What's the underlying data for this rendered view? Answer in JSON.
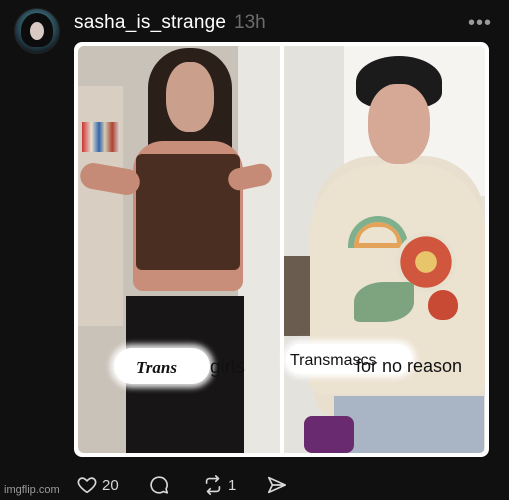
{
  "post": {
    "username": "sasha_is_strange",
    "time": "13h",
    "more_label": "•••",
    "captions": {
      "left_highlight": "Trans",
      "left_text": "girls",
      "right_highlight": "Transmascs",
      "right_text": "for no reason"
    },
    "actions": {
      "likes": "20",
      "reposts": "1"
    }
  },
  "watermark": "imgflip.com",
  "icons": {
    "like": "heart-icon",
    "comment": "comment-icon",
    "repost": "repost-icon",
    "share": "send-icon",
    "more": "more-icon"
  },
  "colors": {
    "background": "#101010",
    "text": "#f2f2f2",
    "muted": "#6c6c6c"
  }
}
